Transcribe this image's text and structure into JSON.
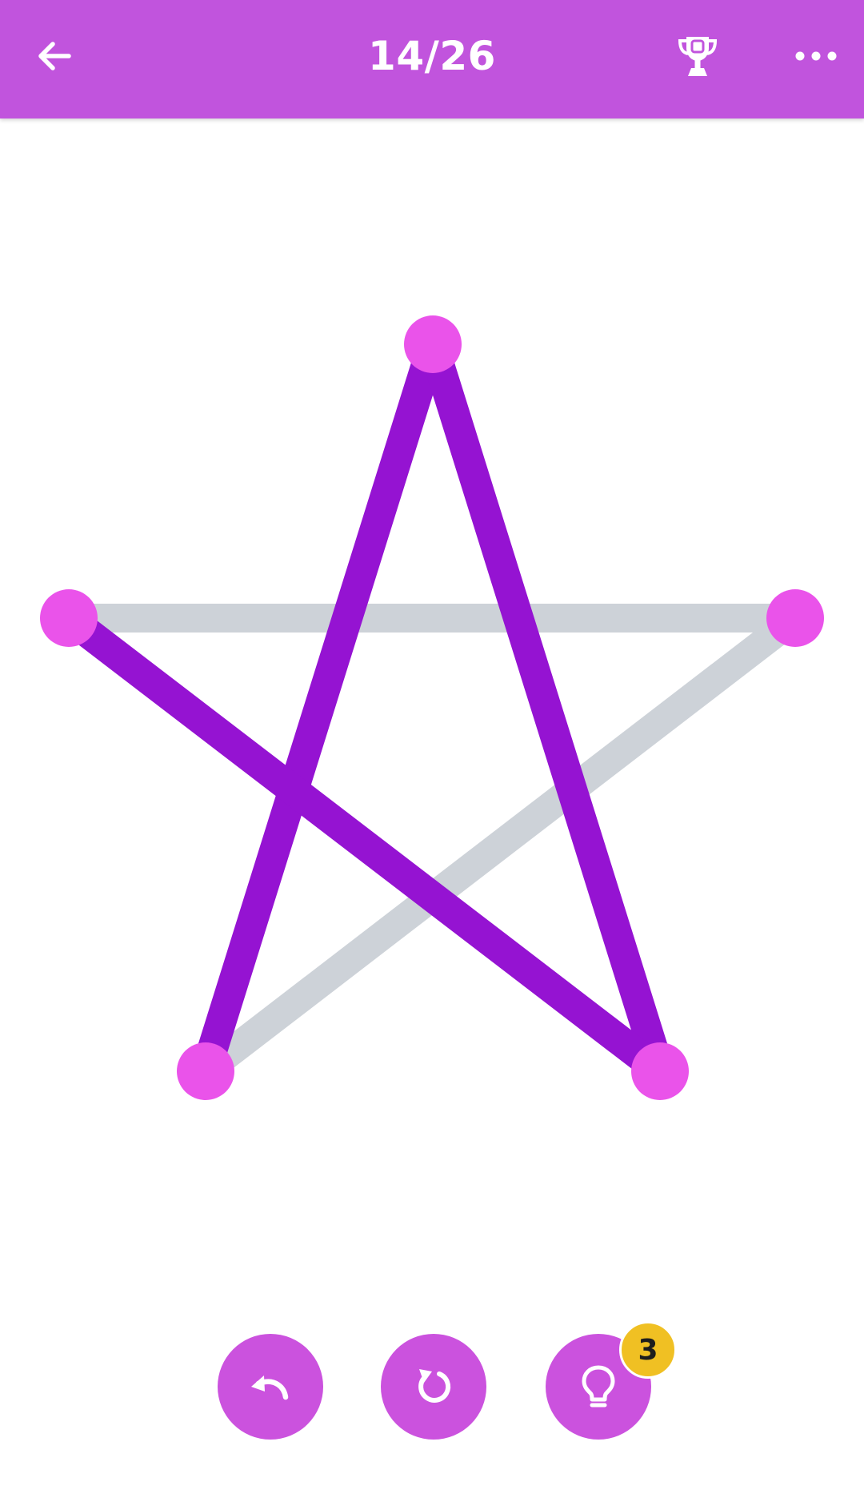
{
  "header": {
    "level_label": "14/26",
    "back_icon": "arrow-left-icon",
    "trophy_icon": "trophy-icon",
    "more_icon": "more-horizontal-icon"
  },
  "colors": {
    "header_bg": "#c154dd",
    "drawn_line": "#9513d2",
    "undrawn_line": "#cdd2d8",
    "node": "#ea53ea",
    "button_bg": "#cb52de",
    "badge_bg": "#f0c023",
    "icon_white": "#ffffff"
  },
  "puzzle": {
    "shape": "five-point star",
    "nodes": [
      "top",
      "left",
      "right",
      "bottom-left",
      "bottom-right"
    ],
    "edges": [
      {
        "from": "top",
        "to": "bottom-left",
        "drawn": true
      },
      {
        "from": "top",
        "to": "bottom-right",
        "drawn": true
      },
      {
        "from": "left",
        "to": "bottom-right",
        "drawn": true
      },
      {
        "from": "left",
        "to": "right",
        "drawn": false
      },
      {
        "from": "right",
        "to": "bottom-left",
        "drawn": false
      }
    ]
  },
  "controls": {
    "undo_icon": "undo-icon",
    "restart_icon": "restart-icon",
    "hint_icon": "lightbulb-icon",
    "hint_count": "3"
  }
}
